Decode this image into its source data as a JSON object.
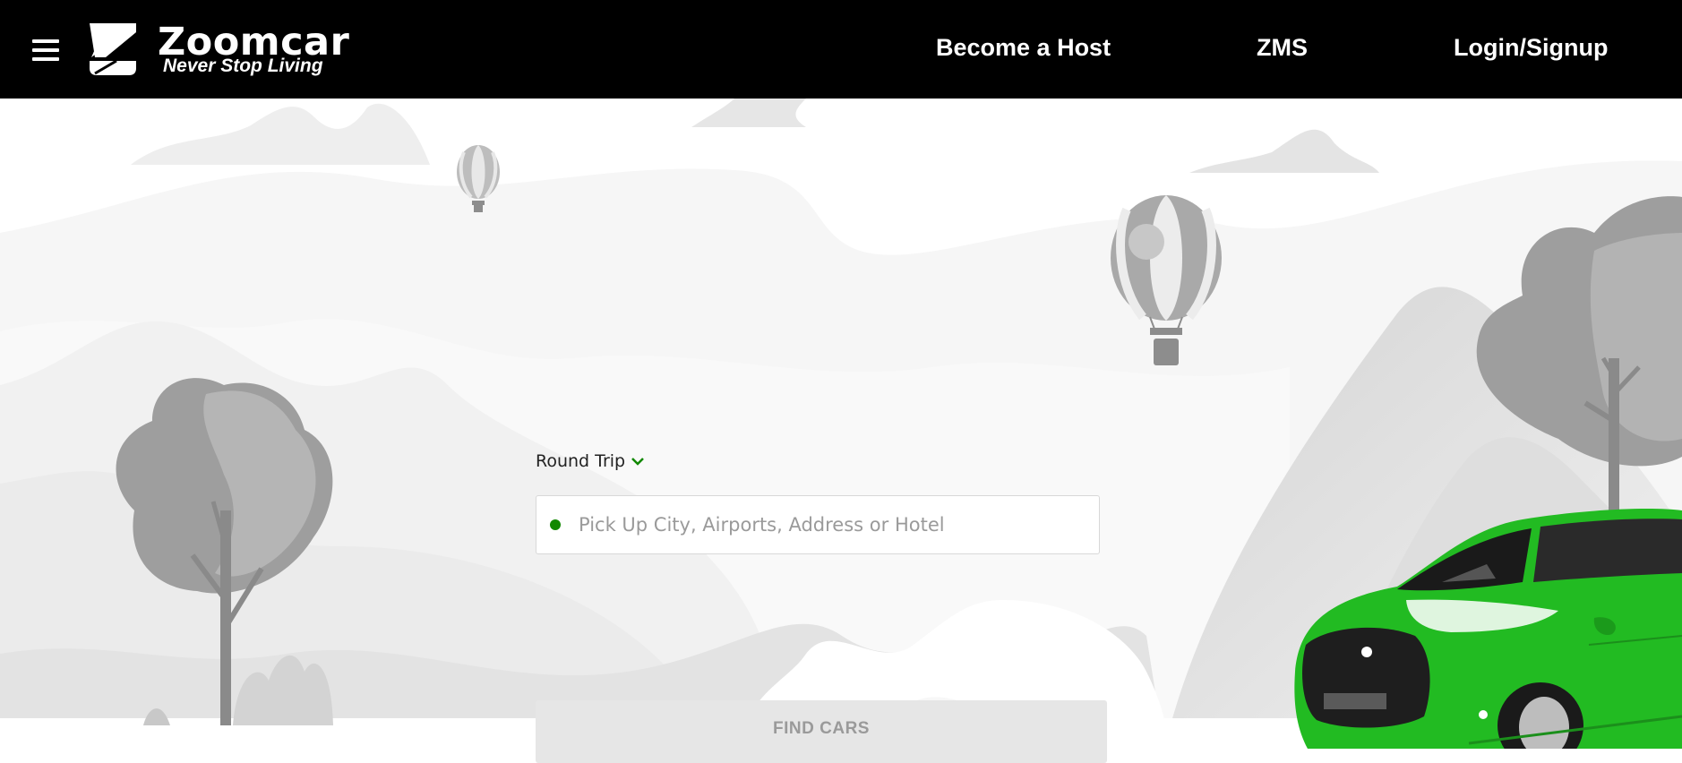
{
  "header": {
    "menu_icon": "hamburger-menu-icon",
    "logo": {
      "name": "Zoomcar",
      "tagline": "Never Stop Living"
    },
    "nav": {
      "become_host": "Become a Host",
      "zms": "ZMS",
      "login": "Login/Signup"
    }
  },
  "search": {
    "trip_type": "Round Trip",
    "trip_type_icon": "chevron-down-icon",
    "pickup_placeholder": "Pick Up City, Airports, Address or Hotel",
    "pickup_value": "",
    "find_label": "FIND CARS"
  },
  "colors": {
    "header_bg": "#000000",
    "accent_green": "#118800",
    "car_green": "#22bb22",
    "scene_gray": "#9e9e9e"
  }
}
